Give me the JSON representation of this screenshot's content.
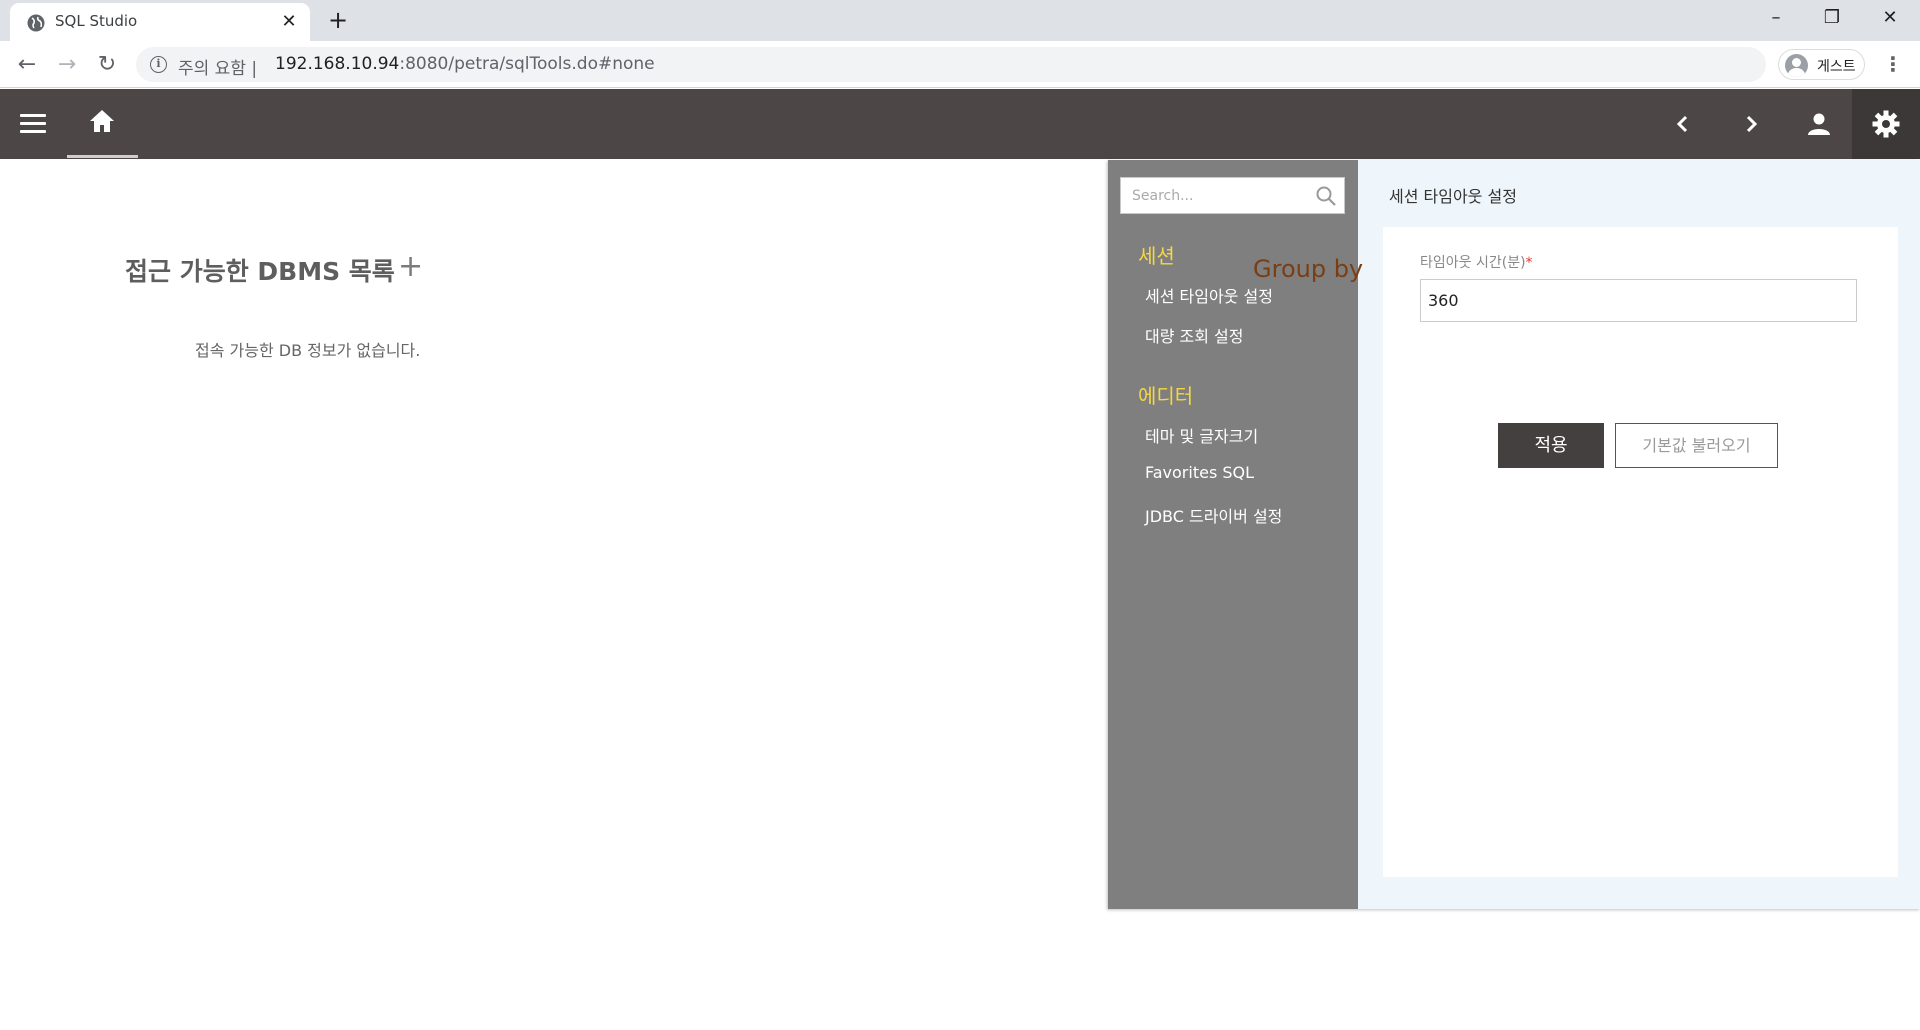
{
  "browser": {
    "tab_title": "SQL Studio",
    "tab_close": "✕",
    "new_tab": "+",
    "omnibox": {
      "security_label": "주의 요함 |",
      "host": "192.168.10.94",
      "path": ":8080/petra/sqlTools.do#none"
    },
    "profile_label": "게스트",
    "window_controls": {
      "minimize": "–",
      "restore": "❐",
      "close": "✕"
    },
    "nav": {
      "back": "←",
      "forward": "→",
      "reload": "↻",
      "menu": "⋮"
    }
  },
  "app_header": {
    "icons": [
      "menu-icon",
      "home-icon",
      "chevron-left-icon",
      "chevron-right-icon",
      "user-icon",
      "gear-icon"
    ]
  },
  "main": {
    "title": "접근 가능한 DBMS 목록",
    "add_symbol": "+",
    "empty_message": "접속 가능한 DB 정보가 없습니다."
  },
  "settings": {
    "search_placeholder": "Search...",
    "groups": [
      {
        "label": "세션",
        "items": [
          "세션 타임아웃 설정",
          "대량 조회 설정"
        ]
      },
      {
        "label": "에디터",
        "items": [
          "테마 및 글자크기",
          "Favorites SQL",
          "JDBC 드라이버 설정"
        ]
      }
    ],
    "overlay_text": "Group by",
    "content": {
      "title": "세션 타임아웃 설정",
      "field_label": "타임아웃 시간(분)",
      "required_mark": "*",
      "field_value": "360",
      "apply_label": "적용",
      "default_label": "기본값 불러오기"
    }
  },
  "colors": {
    "header_bg": "#4c4646",
    "nav_bg": "#7f7f7f",
    "nav_group": "#f5d742",
    "panel_bg": "#eef6fb",
    "apply_bg": "#444040"
  }
}
